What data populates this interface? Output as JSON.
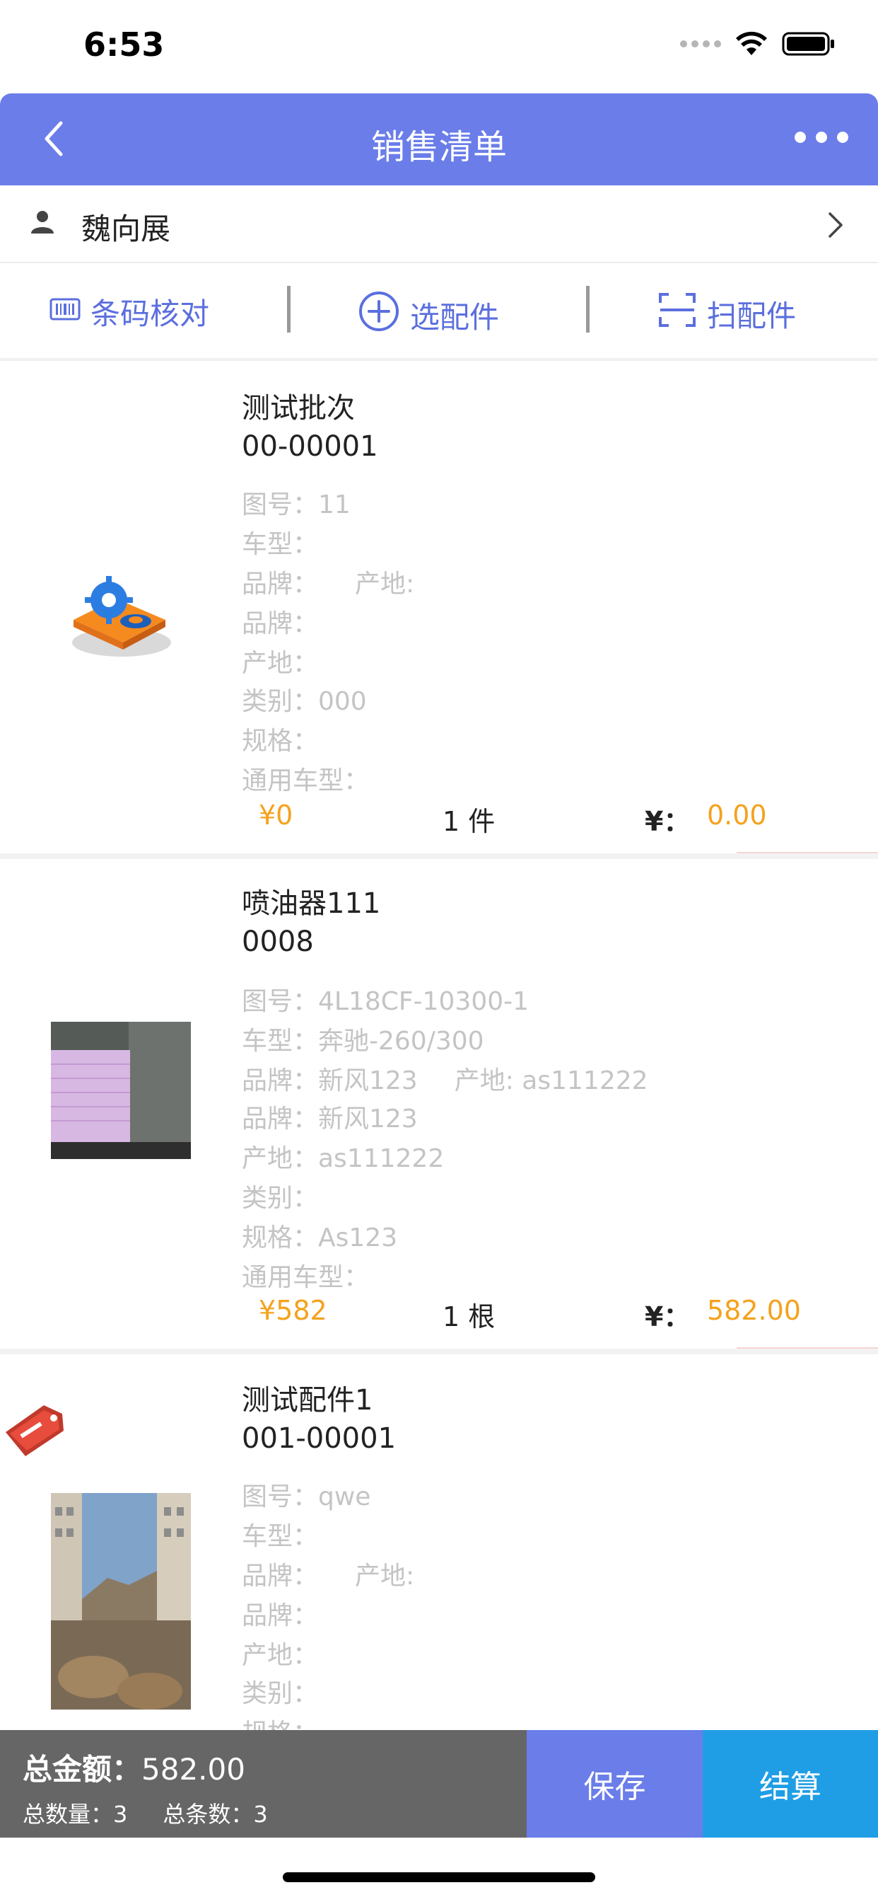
{
  "status_bar": {
    "time": "6:53"
  },
  "nav": {
    "title": "销售清单"
  },
  "customer": {
    "name": "魏向展"
  },
  "toolbar": {
    "barcode_label": "条码核对",
    "select_label": "选配件",
    "scan_label": "扫配件"
  },
  "items": [
    {
      "name": "测试批次",
      "code": "00-00001",
      "drawing_no": "图号：11",
      "model": "车型：",
      "brand_origin_brand": "品牌：",
      "brand_origin_origin": "产地:",
      "brand": "品牌：",
      "origin": "产地：",
      "category": "类别：000",
      "spec": "规格：",
      "universal_model": "通用车型：",
      "price": "¥0",
      "quantity": "1 件",
      "amount_label": "¥：",
      "amount": "0.00",
      "thumb": "gear-settings-icon"
    },
    {
      "name": "喷油器111",
      "code": "0008",
      "drawing_no": "图号：4L18CF-10300-1",
      "model": "车型：奔驰-260/300",
      "brand_origin_brand": "品牌：新风123",
      "brand_origin_origin": "产地: as111222",
      "brand": "品牌：新风123",
      "origin": "产地：as111222",
      "category": "类别：",
      "spec": "规格：As123",
      "universal_model": "通用车型：",
      "price": "¥582",
      "quantity": "1 根",
      "amount_label": "¥：",
      "amount": "582.00",
      "thumb": "screen-photo"
    },
    {
      "name": "测试配件1",
      "code": "001-00001",
      "drawing_no": "图号：qwe",
      "model": "车型：",
      "brand_origin_brand": "品牌：",
      "brand_origin_origin": "产地:",
      "brand": "品牌：",
      "origin": "产地：",
      "category": "类别：",
      "spec": "规格：",
      "thumb": "street-photo",
      "tag": "tag-icon"
    }
  ],
  "summary": {
    "total_amount_label": "总金额：",
    "total_amount": "582.00",
    "total_qty": "总数量：3",
    "total_lines": "总条数：3"
  },
  "actions": {
    "save_label": "保存",
    "checkout_label": "结算"
  },
  "colors": {
    "primary": "#6a7de9",
    "accent": "#1f9ee5",
    "price": "#f4a21d",
    "summary_bg": "#666666"
  }
}
